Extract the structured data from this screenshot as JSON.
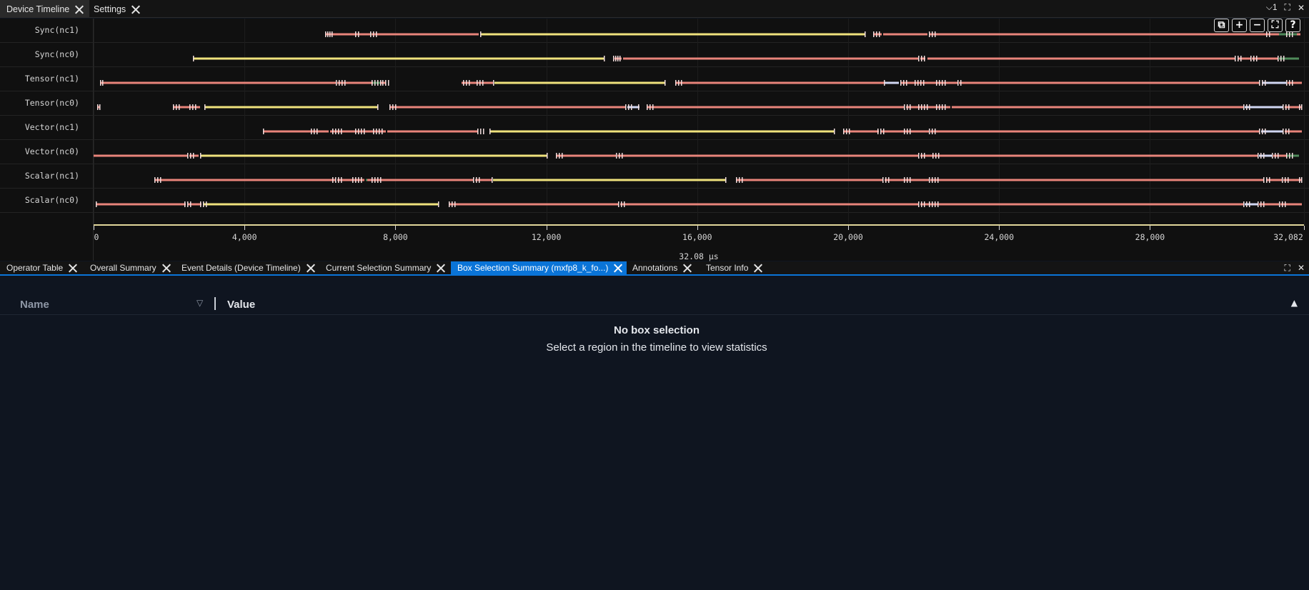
{
  "top_tabs": [
    {
      "label": "Device Timeline",
      "active": true
    },
    {
      "label": "Settings",
      "active": false
    }
  ],
  "window_controls": {
    "chevron": "⌵",
    "count": "1"
  },
  "timeline": {
    "tracks": [
      {
        "label": "Sync(nc1)"
      },
      {
        "label": "Sync(nc0)"
      },
      {
        "label": "Tensor(nc1)"
      },
      {
        "label": "Tensor(nc0)"
      },
      {
        "label": "Vector(nc1)"
      },
      {
        "label": "Vector(nc0)"
      },
      {
        "label": "Scalar(nc1)"
      },
      {
        "label": "Scalar(nc0)"
      }
    ],
    "axis": {
      "ticks": [
        "0",
        "4,000",
        "8,000",
        "12,000",
        "16,000",
        "20,000",
        "24,000",
        "28,000",
        "32,082"
      ],
      "unit_label": "32.08 µs"
    },
    "tools": [
      {
        "name": "copy-icon",
        "glyph": "⧉"
      },
      {
        "name": "zoom-in-icon",
        "glyph": "+"
      },
      {
        "name": "zoom-out-icon",
        "glyph": "−"
      },
      {
        "name": "fit-icon",
        "glyph": "⛶"
      },
      {
        "name": "help-icon",
        "glyph": "?"
      }
    ],
    "colors": {
      "compute": "#e8847a",
      "long_op": "#efe27c",
      "dma": "#4f8a5a",
      "marker": "#d0d6f2"
    }
  },
  "bottom_tabs": [
    {
      "label": "Operator Table",
      "active": false
    },
    {
      "label": "Overall Summary",
      "active": false
    },
    {
      "label": "Event Details (Device Timeline)",
      "active": false
    },
    {
      "label": "Current Selection Summary",
      "active": false
    },
    {
      "label": "Box Selection Summary (mxfp8_k_fo...)",
      "active": true
    },
    {
      "label": "Annotations",
      "active": false
    },
    {
      "label": "Tensor Info",
      "active": false
    }
  ],
  "summary": {
    "col_name": "Name",
    "col_value": "Value",
    "filter_icon": "▽",
    "sort_icon": "▲",
    "empty_title": "No box selection",
    "empty_subtitle": "Select a region in the timeline to view statistics"
  }
}
